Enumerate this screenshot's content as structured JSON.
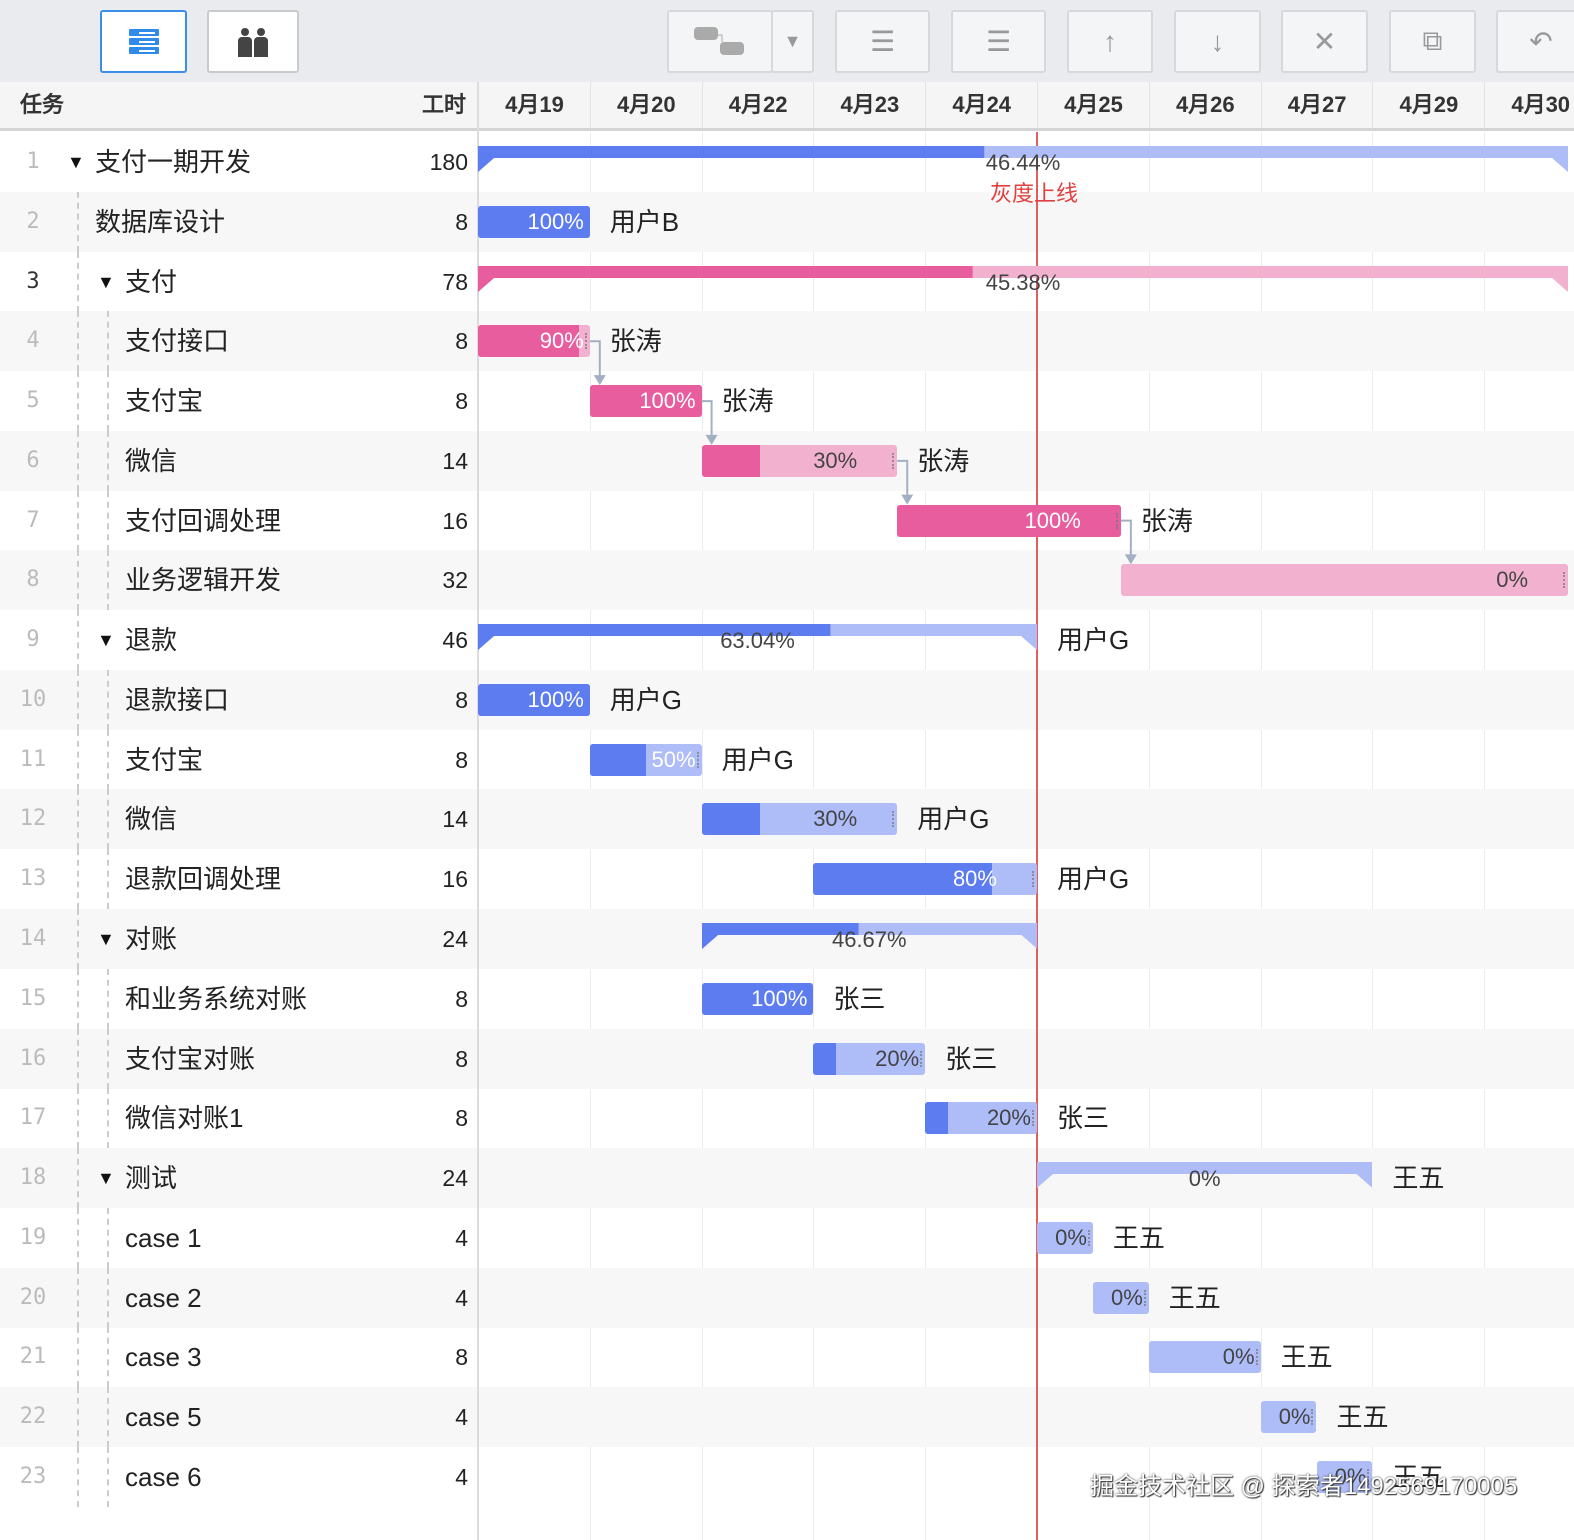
{
  "toolbar": {
    "buttons": [
      {
        "name": "task-view-button",
        "icon": "list-icon"
      },
      {
        "name": "resource-view-button",
        "icon": "users-icon"
      },
      {
        "name": "link-button",
        "icon": "link-tasks-icon"
      },
      {
        "name": "link-dropdown-button",
        "icon": "chevron-down-icon"
      },
      {
        "name": "outdent-button",
        "icon": "outdent-icon"
      },
      {
        "name": "indent-button",
        "icon": "indent-icon"
      },
      {
        "name": "move-up-button",
        "icon": "arrow-up-icon"
      },
      {
        "name": "move-down-button",
        "icon": "arrow-down-icon"
      },
      {
        "name": "delete-button",
        "icon": "close-icon"
      },
      {
        "name": "copy-button",
        "icon": "copy-icon"
      },
      {
        "name": "undo-button",
        "icon": "undo-icon"
      }
    ]
  },
  "header": {
    "task_label": "任务",
    "hours_label": "工时",
    "dates": [
      "4月19",
      "4月20",
      "4月22",
      "4月23",
      "4月24",
      "4月25",
      "4月26",
      "4月27",
      "4月29",
      "4月30"
    ]
  },
  "colors": {
    "blue": "#5c7cf0",
    "blue_light": "#aebcf8",
    "pink": "#e85d9e",
    "pink_light": "#f2b2cf",
    "today": "#e06060"
  },
  "today_marker": {
    "label": "灰度上线",
    "day": 5
  },
  "tasks": [
    {
      "num": "1",
      "name": "支付一期开发",
      "hours": "180",
      "level": 0,
      "group": true,
      "color": "blue",
      "start": 0,
      "duration": 9.75,
      "progress": 0.4644,
      "pct": "46.44%",
      "assignee": ""
    },
    {
      "num": "2",
      "name": "数据库设计",
      "hours": "8",
      "level": 1,
      "group": false,
      "color": "blue",
      "start": 0,
      "duration": 1,
      "progress": 1,
      "pct": "100%",
      "assignee": "用户B"
    },
    {
      "num": "3",
      "name": "支付",
      "hours": "78",
      "level": 1,
      "group": true,
      "color": "pink",
      "start": 0,
      "duration": 9.75,
      "progress": 0.4538,
      "pct": "45.38%",
      "assignee": "",
      "selected": true
    },
    {
      "num": "4",
      "name": "支付接口",
      "hours": "8",
      "level": 2,
      "group": false,
      "color": "pink",
      "start": 0,
      "duration": 1,
      "progress": 0.9,
      "pct": "90%",
      "assignee": "张涛"
    },
    {
      "num": "5",
      "name": "支付宝",
      "hours": "8",
      "level": 2,
      "group": false,
      "color": "pink",
      "start": 1,
      "duration": 1,
      "progress": 1,
      "pct": "100%",
      "assignee": "张涛"
    },
    {
      "num": "6",
      "name": "微信",
      "hours": "14",
      "level": 2,
      "group": false,
      "color": "pink",
      "start": 2,
      "duration": 1.75,
      "progress": 0.3,
      "pct": "30%",
      "assignee": "张涛"
    },
    {
      "num": "7",
      "name": "支付回调处理",
      "hours": "16",
      "level": 2,
      "group": false,
      "color": "pink",
      "start": 3.75,
      "duration": 2,
      "progress": 1,
      "pct": "100%",
      "assignee": "张涛"
    },
    {
      "num": "8",
      "name": "业务逻辑开发",
      "hours": "32",
      "level": 2,
      "group": false,
      "color": "pink",
      "start": 5.75,
      "duration": 4,
      "progress": 0,
      "pct": "0%",
      "assignee": ""
    },
    {
      "num": "9",
      "name": "退款",
      "hours": "46",
      "level": 1,
      "group": true,
      "color": "blue",
      "start": 0,
      "duration": 5,
      "progress": 0.6304,
      "pct": "63.04%",
      "assignee": "用户G"
    },
    {
      "num": "10",
      "name": "退款接口",
      "hours": "8",
      "level": 2,
      "group": false,
      "color": "blue",
      "start": 0,
      "duration": 1,
      "progress": 1,
      "pct": "100%",
      "assignee": "用户G"
    },
    {
      "num": "11",
      "name": "支付宝",
      "hours": "8",
      "level": 2,
      "group": false,
      "color": "blue",
      "start": 1,
      "duration": 1,
      "progress": 0.5,
      "pct": "50%",
      "assignee": "用户G"
    },
    {
      "num": "12",
      "name": "微信",
      "hours": "14",
      "level": 2,
      "group": false,
      "color": "blue",
      "start": 2,
      "duration": 1.75,
      "progress": 0.3,
      "pct": "30%",
      "assignee": "用户G"
    },
    {
      "num": "13",
      "name": "退款回调处理",
      "hours": "16",
      "level": 2,
      "group": false,
      "color": "blue",
      "start": 3,
      "duration": 2,
      "progress": 0.8,
      "pct": "80%",
      "assignee": "用户G"
    },
    {
      "num": "14",
      "name": "对账",
      "hours": "24",
      "level": 1,
      "group": true,
      "color": "blue",
      "start": 2,
      "duration": 3,
      "progress": 0.4667,
      "pct": "46.67%",
      "assignee": ""
    },
    {
      "num": "15",
      "name": "和业务系统对账",
      "hours": "8",
      "level": 2,
      "group": false,
      "color": "blue",
      "start": 2,
      "duration": 1,
      "progress": 1,
      "pct": "100%",
      "assignee": "张三"
    },
    {
      "num": "16",
      "name": "支付宝对账",
      "hours": "8",
      "level": 2,
      "group": false,
      "color": "blue",
      "start": 3,
      "duration": 1,
      "progress": 0.2,
      "pct": "20%",
      "assignee": "张三"
    },
    {
      "num": "17",
      "name": "微信对账1",
      "hours": "8",
      "level": 2,
      "group": false,
      "color": "blue",
      "start": 4,
      "duration": 1,
      "progress": 0.2,
      "pct": "20%",
      "assignee": "张三"
    },
    {
      "num": "18",
      "name": "测试",
      "hours": "24",
      "level": 1,
      "group": true,
      "color": "blue",
      "start": 5,
      "duration": 3,
      "progress": 0,
      "pct": "0%",
      "assignee": "王五"
    },
    {
      "num": "19",
      "name": "case 1",
      "hours": "4",
      "level": 2,
      "group": false,
      "color": "blue",
      "start": 5,
      "duration": 0.5,
      "progress": 0,
      "pct": "0%",
      "assignee": "王五"
    },
    {
      "num": "20",
      "name": "case 2",
      "hours": "4",
      "level": 2,
      "group": false,
      "color": "blue",
      "start": 5.5,
      "duration": 0.5,
      "progress": 0,
      "pct": "0%",
      "assignee": "王五"
    },
    {
      "num": "21",
      "name": "case 3",
      "hours": "8",
      "level": 2,
      "group": false,
      "color": "blue",
      "start": 6,
      "duration": 1,
      "progress": 0,
      "pct": "0%",
      "assignee": "王五"
    },
    {
      "num": "22",
      "name": "case 5",
      "hours": "4",
      "level": 2,
      "group": false,
      "color": "blue",
      "start": 7,
      "duration": 0.5,
      "progress": 0,
      "pct": "0%",
      "assignee": "王五"
    },
    {
      "num": "23",
      "name": "case 6",
      "hours": "4",
      "level": 2,
      "group": false,
      "color": "blue",
      "start": 7.5,
      "duration": 0.5,
      "progress": 0,
      "pct": "0%",
      "assignee": "王五"
    }
  ],
  "links": [
    [
      3,
      4
    ],
    [
      4,
      5
    ],
    [
      5,
      6
    ],
    [
      6,
      7
    ]
  ],
  "watermark": "掘金技术社区 @ 探索者1492569170005"
}
